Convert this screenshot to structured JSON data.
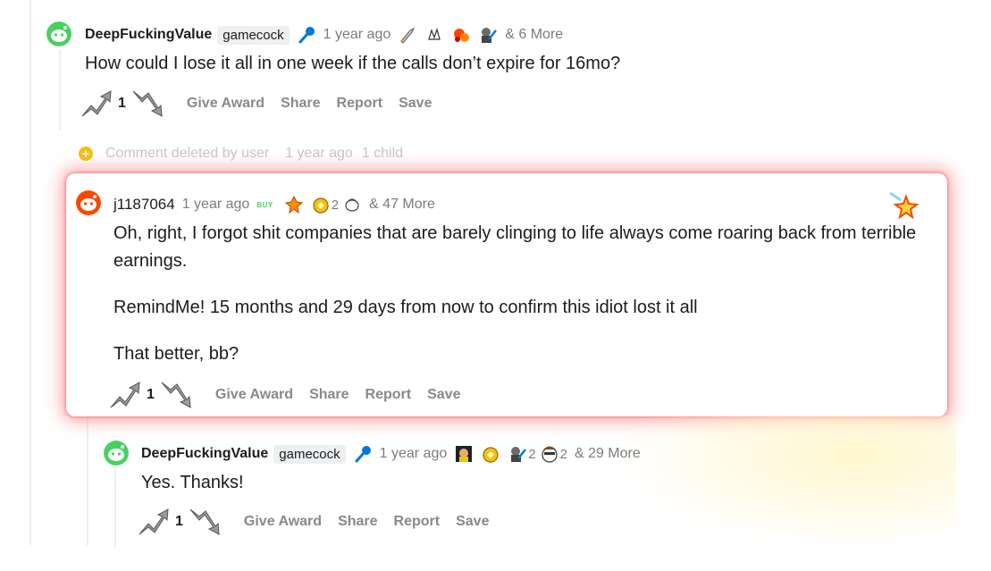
{
  "comment1": {
    "username": "DeepFuckingValue",
    "flair": "gamecock",
    "time": "1 year ago",
    "more": "& 6 More",
    "body": "How could I lose it all in one week if the calls don’t expire for 16mo?",
    "score": "1"
  },
  "deleted": {
    "text": "Comment deleted by user",
    "time": "1 year ago",
    "children": "1 child"
  },
  "comment2": {
    "username": "j1187064",
    "time": "1 year ago",
    "buy_badge": "BUY",
    "award_count": "2",
    "more": "& 47 More",
    "body_p1": "Oh, right, I forgot shit companies that are barely clinging to life always come roaring back from terrible earnings.",
    "body_p2": "RemindMe! 15 months and 29 days from now to confirm this idiot lost it all",
    "body_p3": "That better, bb?",
    "score": "1"
  },
  "comment3": {
    "username": "DeepFuckingValue",
    "flair": "gamecock",
    "time": "1 year ago",
    "award_count_a": "2",
    "award_count_b": "2",
    "more": "& 29 More",
    "body": "Yes. Thanks!",
    "score": "1"
  },
  "actions": {
    "give_award": "Give Award",
    "share": "Share",
    "report": "Report",
    "save": "Save"
  },
  "colors": {
    "avatar_green": "#46d160",
    "avatar_red": "#ff4500",
    "meta_gray": "#7c7c7c",
    "action_gray": "#878a8c",
    "highlight_glow": "#ff6e6e"
  }
}
